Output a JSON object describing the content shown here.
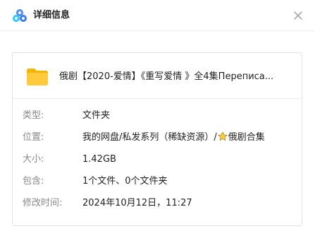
{
  "header": {
    "title": "详细信息",
    "logo_icon": "baidu-netdisk-logo-icon",
    "close_icon": "close-icon"
  },
  "file": {
    "icon": "folder-icon",
    "name": "俄剧【2020-爱情】《重写爱情 》全4集Переписа..."
  },
  "details": {
    "type": {
      "label": "类型:",
      "value": "文件夹"
    },
    "location": {
      "label": "位置:",
      "value_before_star": "我的网盘/私发系列（稀缺资源）/",
      "star_icon": "star-icon",
      "value_after_star": "俄剧合集"
    },
    "size": {
      "label": "大小:",
      "value": "1.42GB"
    },
    "contains": {
      "label": "包含:",
      "value": "1个文件、0个文件夹"
    },
    "modified": {
      "label": "修改时间:",
      "value": "2024年10月12日，11:27"
    }
  },
  "colors": {
    "folder": "#FFCB3D",
    "folder_tab": "#F5B400",
    "label": "#8a8a8a",
    "text": "#222222",
    "border": "#e3e3e3",
    "star": "#F5B400"
  }
}
